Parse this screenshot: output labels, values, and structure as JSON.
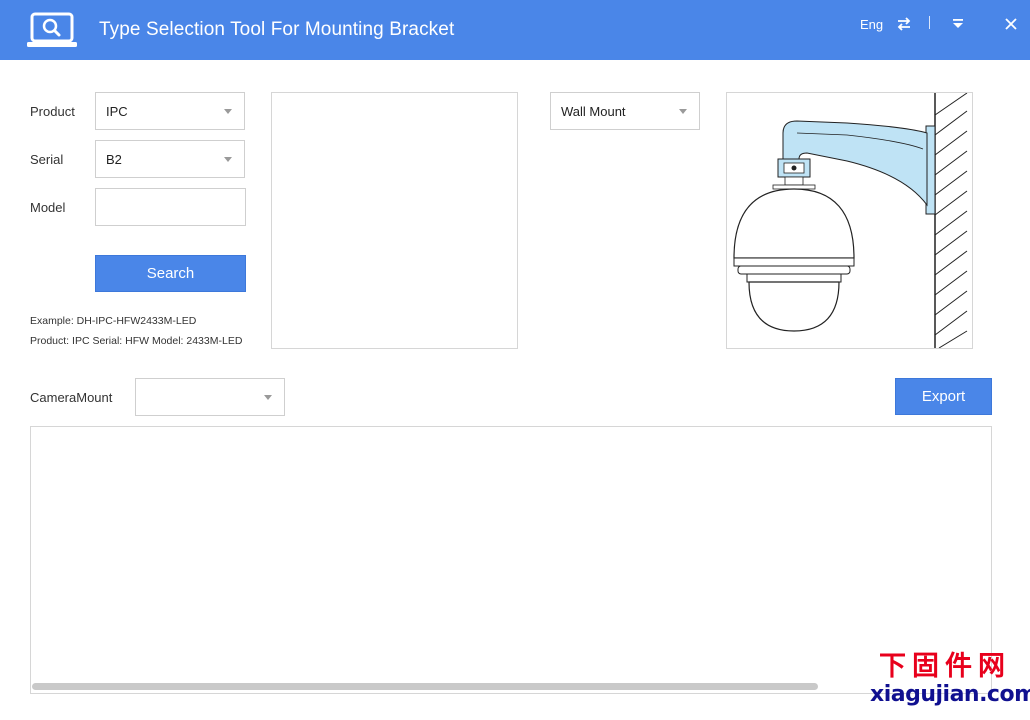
{
  "window": {
    "title": "Type Selection Tool For Mounting Bracket",
    "language": "Eng",
    "accent_color": "#4a86e8"
  },
  "form": {
    "product": {
      "label": "Product",
      "value": "IPC"
    },
    "serial": {
      "label": "Serial",
      "value": "B2"
    },
    "model": {
      "label": "Model",
      "value": "",
      "placeholder": ""
    },
    "search_label": "Search",
    "example_line1": "Example: DH-IPC-HFW2433M-LED",
    "example_line2": "Product: IPC Serial: HFW Model: 2433M-LED"
  },
  "mount": {
    "type_value": "Wall Mount",
    "preview_icon": "wall-mount-dome-camera-illustration"
  },
  "camera_mount": {
    "label": "CameraMount",
    "value": ""
  },
  "export_label": "Export",
  "watermark": {
    "cn": "下固件网",
    "url": "xiagujian.com"
  }
}
